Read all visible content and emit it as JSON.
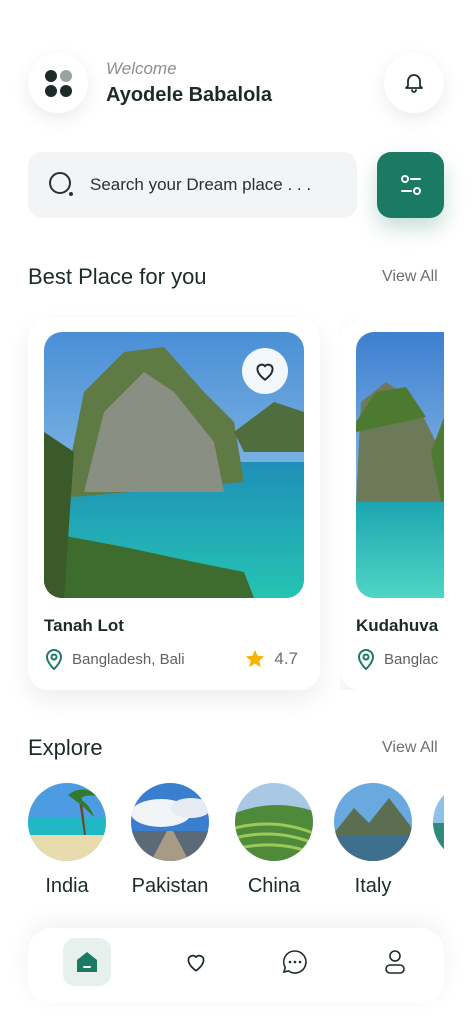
{
  "header": {
    "welcome": "Welcome",
    "user_name": "Ayodele Babalola",
    "menu_icon": "grid-dots-icon",
    "bell_icon": "bell-icon"
  },
  "search": {
    "placeholder": "Search your Dream place . . .",
    "search_icon": "search-icon",
    "filter_icon": "filter-icon"
  },
  "best_places": {
    "title": "Best Place for you",
    "view_all": "View All",
    "cards": [
      {
        "name": "Tanah Lot",
        "location": "Bangladesh, Bali",
        "rating": "4.7"
      },
      {
        "name": "Kudahuva",
        "location": "Banglac"
      }
    ]
  },
  "explore": {
    "title": "Explore",
    "view_all": "View All",
    "items": [
      "India",
      "Pakistan",
      "China",
      "Italy"
    ]
  },
  "nav": {
    "items": [
      "home-icon",
      "heart-icon",
      "chat-icon",
      "profile-icon"
    ],
    "active": "home-icon"
  },
  "colors": {
    "accent": "#1b7a63",
    "accent_light": "#e6f1ed",
    "star": "#f5b400"
  }
}
